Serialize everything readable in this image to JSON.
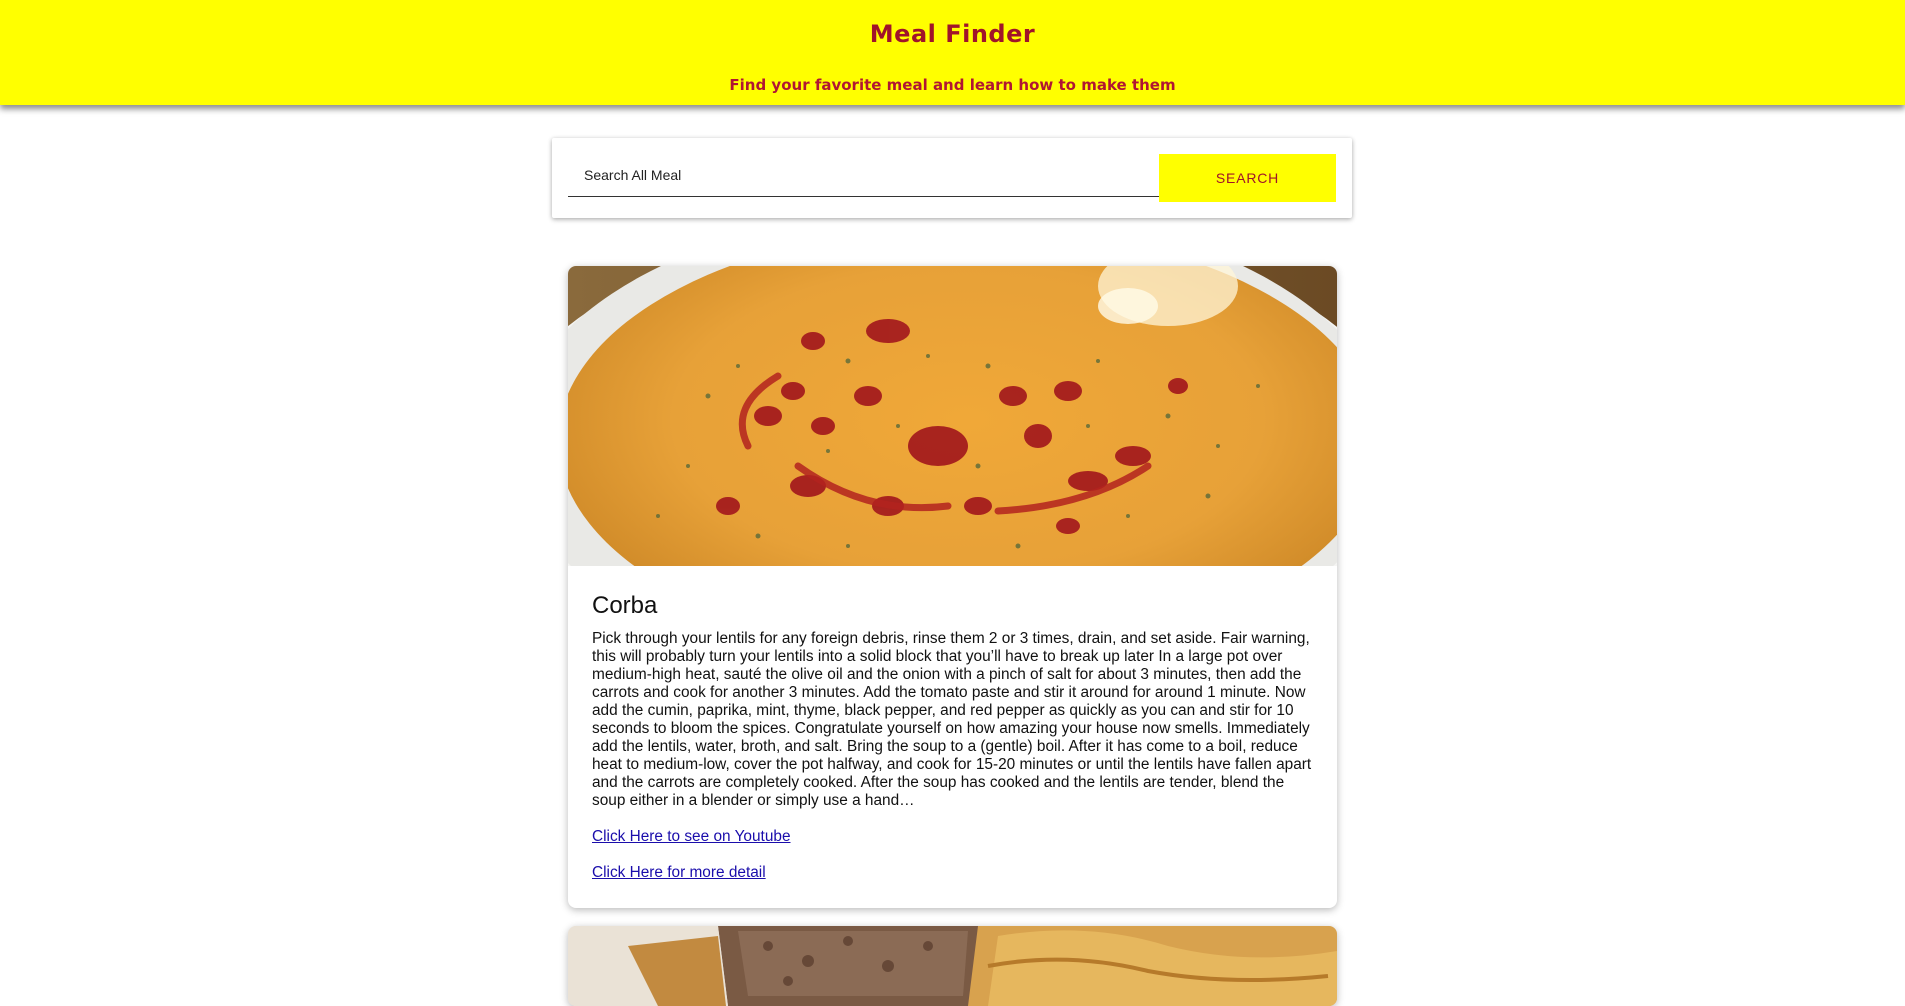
{
  "header": {
    "title": "Meal Finder",
    "subtitle": "Find your favorite meal and learn how to make them",
    "background_color": "#ffff00",
    "text_color": "#a0142a"
  },
  "search": {
    "placeholder": "Search All Meal",
    "value": "",
    "button_label": "SEARCH"
  },
  "meals": [
    {
      "name": "Corba",
      "image_icon": "lentil-soup-photo",
      "description": "Pick through your lentils for any foreign debris, rinse them 2 or 3 times, drain, and set aside. Fair warning, this will probably turn your lentils into a solid block that you’ll have to break up later In a large pot over medium-high heat, sauté the olive oil and the onion with a pinch of salt for about 3 minutes, then add the carrots and cook for another 3 minutes. Add the tomato paste and stir it around for around 1 minute. Now add the cumin, paprika, mint, thyme, black pepper, and red pepper as quickly as you can and stir for 10 seconds to bloom the spices. Congratulate yourself on how amazing your house now smells. Immediately add the lentils, water, broth, and salt. Bring the soup to a (gentle) boil. After it has come to a boil, reduce heat to medium-low, cover the pot halfway, and cook for 15-20 minutes or until the lentils have fallen apart and the carrots are completely cooked. After the soup has cooked and the lentils are tender, blend the soup either in a blender or simply use a hand…",
      "youtube_link_label": "Click Here to see on Youtube",
      "detail_link_label": "Click Here for more detail"
    },
    {
      "image_icon": "burek-pastry-photo"
    }
  ]
}
